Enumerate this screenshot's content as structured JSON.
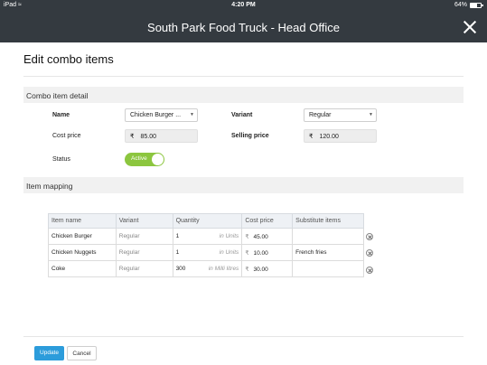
{
  "status_bar": {
    "device": "iPad",
    "time": "4:20 PM",
    "battery": "64%"
  },
  "nav": {
    "title": "South Park Food Truck - Head Office"
  },
  "page_title": "Edit combo items",
  "combo_detail": {
    "header": "Combo item detail",
    "name_label": "Name",
    "name_value": "Chicken Burger ...",
    "variant_label": "Variant",
    "variant_value": "Regular",
    "cost_label": "Cost price",
    "cost_currency": "₹",
    "cost_value": "85.00",
    "selling_label": "Selling price",
    "selling_currency": "₹",
    "selling_value": "120.00",
    "status_label": "Status",
    "status_value": "Active"
  },
  "item_mapping": {
    "header": "Item mapping",
    "columns": [
      "Item name",
      "Variant",
      "Quantity",
      "Cost price",
      "Substitute items"
    ],
    "rows": [
      {
        "item": "Chicken Burger",
        "variant": "Regular",
        "qty": "1",
        "unit": "in Units",
        "currency": "₹",
        "cost": "45.00",
        "substitute": ""
      },
      {
        "item": "Chicken Nuggets",
        "variant": "Regular",
        "qty": "1",
        "unit": "in Units",
        "currency": "₹",
        "cost": "10.00",
        "substitute": "French fries"
      },
      {
        "item": "Coke",
        "variant": "Regular",
        "qty": "300",
        "unit": "in Milli litres",
        "currency": "₹",
        "cost": "30.00",
        "substitute": ""
      }
    ]
  },
  "actions": {
    "update": "Update",
    "cancel": "Cancel"
  },
  "colors": {
    "nav_bg": "#343a40",
    "toggle_active": "#8cc63f",
    "primary": "#2c9cdb"
  }
}
